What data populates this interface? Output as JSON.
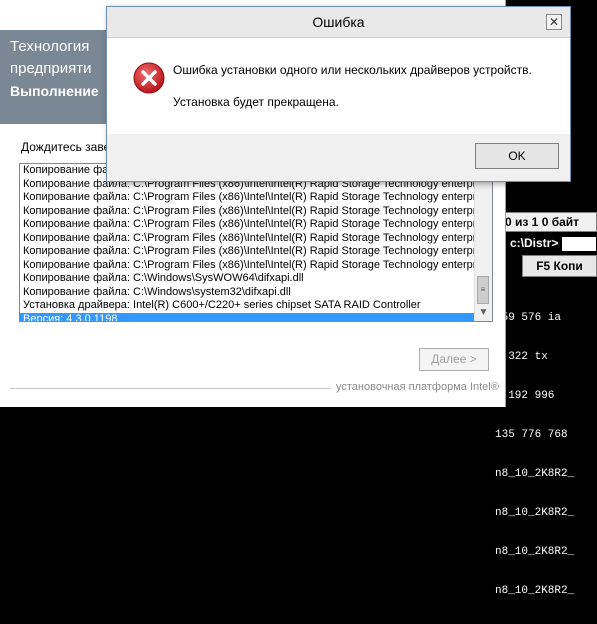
{
  "colors": {
    "selection": "#3399ff",
    "error_red": "#c9252b",
    "dialog_border": "#6d8fb4"
  },
  "background_app": {
    "info_bar": "0 из 1  0 байт",
    "path_label": "c:\\Distr>",
    "f5_label": "F5 Копи",
    "file_sizes": [
      "559 576 ia",
      "5 322 tx",
      "1 192 996",
      "135 776 768"
    ],
    "file_names": [
      "n8_10_2K8R2_",
      "n8_10_2K8R2_",
      "n8_10_2K8R2_",
      "n8_10_2K8R2_"
    ]
  },
  "installer": {
    "banner_lines": [
      "Технология",
      "предприяти",
      "Выполнение"
    ],
    "wait_label": "Дождитесь заве",
    "log_lines": [
      "Копирование фай",
      "Копирование файла: C:\\Program Files (x86)\\Intel\\Intel(R) Rapid Storage Technology enterpr",
      "Копирование файла: C:\\Program Files (x86)\\Intel\\Intel(R) Rapid Storage Technology enterpr",
      "Копирование файла: C:\\Program Files (x86)\\Intel\\Intel(R) Rapid Storage Technology enterpr",
      "Копирование файла: C:\\Program Files (x86)\\Intel\\Intel(R) Rapid Storage Technology enterpr",
      "Копирование файла: C:\\Program Files (x86)\\Intel\\Intel(R) Rapid Storage Technology enterpr",
      "Копирование файла: C:\\Program Files (x86)\\Intel\\Intel(R) Rapid Storage Technology enterpr",
      "Копирование файла: C:\\Program Files (x86)\\Intel\\Intel(R) Rapid Storage Technology enterpr",
      "Копирование файла: C:\\Windows\\SysWOW64\\difxapi.dll",
      "Копирование файла: C:\\Windows\\system32\\difxapi.dll",
      "Установка драйвера: Intel(R) C600+/C220+ series chipset SATA RAID Controller",
      "Версия: 4.3.0.1198"
    ],
    "next_label": "Далее >",
    "footer": "установочная платформа Intel®"
  },
  "dialog": {
    "title": "Ошибка",
    "close_glyph": "✕",
    "message1": "Ошибка установки одного или нескольких драйверов устройств.",
    "message2": "Установка будет прекращена.",
    "ok_label": "OK",
    "icon": "error-x-icon"
  }
}
